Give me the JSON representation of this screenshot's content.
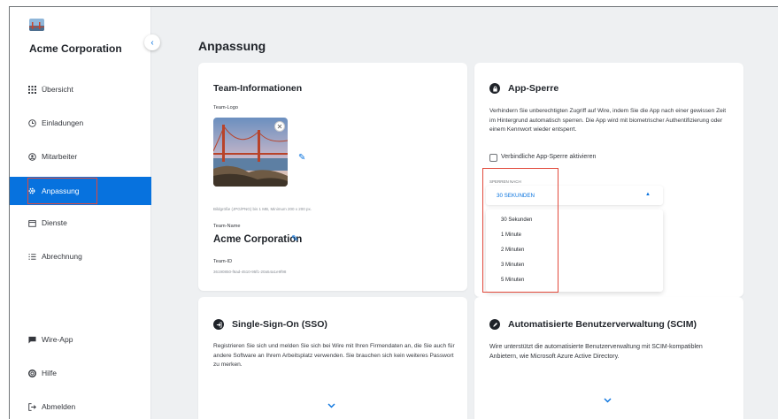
{
  "sidebar": {
    "org_name": "Acme Corporation",
    "collapse_icon": "‹",
    "items": [
      {
        "label": "Übersicht",
        "icon": "grid-icon"
      },
      {
        "label": "Einladungen",
        "icon": "clock-icon"
      },
      {
        "label": "Mitarbeiter",
        "icon": "user-circle-icon"
      },
      {
        "label": "Anpassung",
        "icon": "gear-icon"
      },
      {
        "label": "Dienste",
        "icon": "calendar-icon"
      },
      {
        "label": "Abrechnung",
        "icon": "list-icon"
      }
    ],
    "bottom_items": [
      {
        "label": "Wire-App",
        "icon": "chat-icon"
      },
      {
        "label": "Hilfe",
        "icon": "lifebuoy-icon"
      },
      {
        "label": "Abmelden",
        "icon": "logout-icon"
      }
    ]
  },
  "main": {
    "title": "Anpassung",
    "team_info": {
      "title": "Team-Informationen",
      "logo_label": "Team-Logo",
      "logo_hint": "Bildgröße (JPG/PNG) bis 1 MB, Minimum 200 x 200 px.",
      "name_label": "Team-Name",
      "name_value": "Acme Corporation",
      "id_label": "Team-ID",
      "id_value": "36190850-f6ad-4510-95f1-20a54a1e9f98"
    },
    "app_lock": {
      "title": "App-Sperre",
      "description": "Verhindern Sie unberechtigten Zugriff auf Wire, indem Sie die App nach einer gewissen Zeit im Hintergrund automatisch sperren. Die App wird mit biometrischer Authentifizierung oder einem Kennwort wieder entsperrt.",
      "checkbox_label": "Verbindliche App-Sperre aktivieren",
      "lock_after_label": "SPERREN NACH",
      "selected_value": "30 SEKUNDEN",
      "options": [
        "30 Sekunden",
        "1 Minute",
        "2 Minuten",
        "3 Minuten",
        "5 Minuten"
      ]
    },
    "sso": {
      "title": "Single-Sign-On (SSO)",
      "description": "Registrieren Sie sich und melden Sie sich bei Wire mit Ihren Firmendaten an, die Sie auch für andere Software an Ihrem Arbeitsplatz verwenden. Sie brauchen sich kein weiteres Passwort zu merken."
    },
    "scim": {
      "title": "Automatisierte Benutzerverwaltung (SCIM)",
      "description": "Wire unterstützt die automatisierte Benutzerverwaltung mit SCIM-kompatiblen Anbietern, wie Microsoft Azure Active Directory."
    }
  },
  "colors": {
    "accent": "#0772de",
    "highlight": "#e2493b",
    "background": "#eef0f2"
  }
}
